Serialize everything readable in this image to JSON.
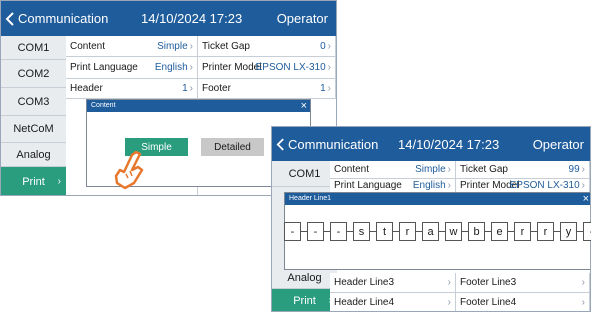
{
  "screen1": {
    "topbar": {
      "title": "Communication",
      "datetime": "14/10/2024 17:23",
      "user": "Operator"
    },
    "sidebar": [
      {
        "label": "COM1",
        "active": false
      },
      {
        "label": "COM2",
        "active": false
      },
      {
        "label": "COM3",
        "active": false
      },
      {
        "label": "NetCoM",
        "active": false
      },
      {
        "label": "Analog",
        "active": false
      },
      {
        "label": "Print",
        "active": true
      }
    ],
    "settings": [
      {
        "label": "Content",
        "value": "Simple"
      },
      {
        "label": "Ticket Gap",
        "value": "0"
      },
      {
        "label": "Print Language",
        "value": "English"
      },
      {
        "label": "Printer Model",
        "value": "EPSON LX-310"
      },
      {
        "label": "Header",
        "value": "1"
      },
      {
        "label": "Footer",
        "value": "1"
      }
    ],
    "dialog": {
      "title": "Content",
      "close": "×",
      "simple_label": "Simple",
      "detailed_label": "Detailed"
    }
  },
  "screen2": {
    "topbar": {
      "title": "Communication",
      "datetime": "14/10/2024 17:23",
      "user": "Operator"
    },
    "sidebar": [
      {
        "label": "COM1",
        "active": false
      },
      {
        "label": "Analog",
        "active": false
      },
      {
        "label": "Print",
        "active": true
      }
    ],
    "settings": [
      {
        "label": "Content",
        "value": "Simple"
      },
      {
        "label": "Ticket Gap",
        "value": "99"
      },
      {
        "label": "Print Language",
        "value": "English"
      },
      {
        "label": "Printer Model",
        "value": "EPSON LX-310"
      },
      {
        "label": "Header Line3",
        "value": ""
      },
      {
        "label": "Footer Line3",
        "value": ""
      },
      {
        "label": "Header Line4",
        "value": ""
      },
      {
        "label": "Footer Line4",
        "value": ""
      }
    ],
    "dialog": {
      "title": "Header Line1",
      "close": "×",
      "chars": [
        "-",
        "-",
        "-",
        "s",
        "t",
        "r",
        "a",
        "w",
        "b",
        "e",
        "r",
        "r",
        "y",
        "-",
        "-",
        "-"
      ]
    }
  },
  "icons": {
    "back": "chevron-left-icon",
    "pointer": "hand-pointer-icon"
  },
  "colors": {
    "header": "#1f5c9c",
    "accent": "#2a9d7f",
    "sidebar": "#e9ecef",
    "value": "#1f5c9c"
  }
}
